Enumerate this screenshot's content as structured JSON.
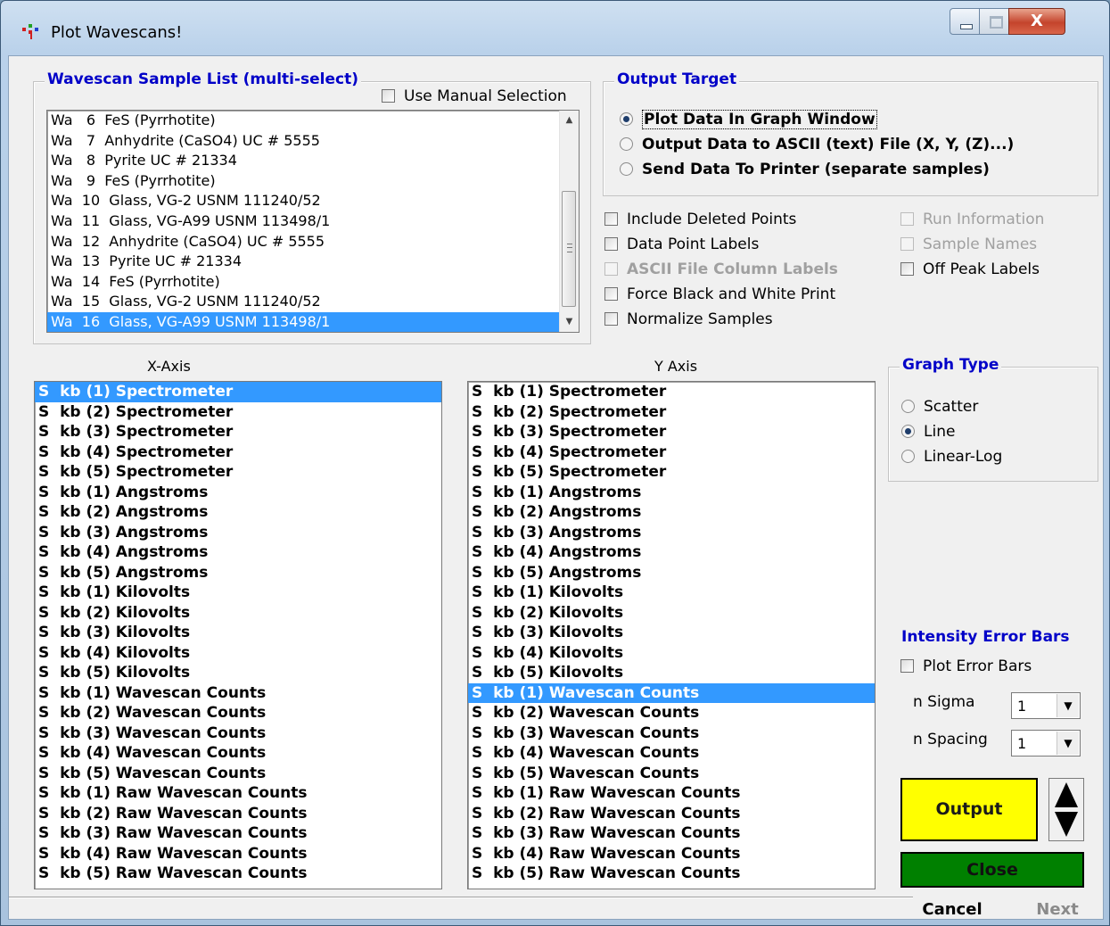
{
  "window": {
    "title": "Plot Wavescans!"
  },
  "controls": {
    "close_glyph": "X"
  },
  "sample_list": {
    "legend": "Wavescan Sample List (multi-select)",
    "manual_selection_label": "Use Manual Selection",
    "items": [
      "Wa   6  FeS (Pyrrhotite)",
      "Wa   7  Anhydrite (CaSO4) UC # 5555",
      "Wa   8  Pyrite UC # 21334",
      "Wa   9  FeS (Pyrrhotite)",
      "Wa  10  Glass, VG-2 USNM 111240/52",
      "Wa  11  Glass, VG-A99 USNM 113498/1",
      "Wa  12  Anhydrite (CaSO4) UC # 5555",
      "Wa  13  Pyrite UC # 21334",
      "Wa  14  FeS (Pyrrhotite)",
      "Wa  15  Glass, VG-2 USNM 111240/52",
      "Wa  16  Glass, VG-A99 USNM 113498/1"
    ],
    "selected_index": 10
  },
  "output_target": {
    "legend": "Output Target",
    "options": [
      "Plot Data In Graph Window",
      "Output Data to ASCII (text) File (X, Y, (Z)...)",
      "Send Data To Printer (separate samples)"
    ],
    "selected_index": 0
  },
  "options": {
    "include_deleted": "Include Deleted Points",
    "data_point_labels": "Data Point Labels",
    "ascii_column_labels": "ASCII File Column Labels",
    "force_bw": "Force Black and White Print",
    "normalize": "Normalize Samples",
    "run_information": "Run Information",
    "sample_names": "Sample Names",
    "off_peak_labels": "Off Peak Labels"
  },
  "x_axis": {
    "label": "X-Axis",
    "items": [
      "S  kb (1) Spectrometer",
      "S  kb (2) Spectrometer",
      "S  kb (3) Spectrometer",
      "S  kb (4) Spectrometer",
      "S  kb (5) Spectrometer",
      "S  kb (1) Angstroms",
      "S  kb (2) Angstroms",
      "S  kb (3) Angstroms",
      "S  kb (4) Angstroms",
      "S  kb (5) Angstroms",
      "S  kb (1) Kilovolts",
      "S  kb (2) Kilovolts",
      "S  kb (3) Kilovolts",
      "S  kb (4) Kilovolts",
      "S  kb (5) Kilovolts",
      "S  kb (1) Wavescan Counts",
      "S  kb (2) Wavescan Counts",
      "S  kb (3) Wavescan Counts",
      "S  kb (4) Wavescan Counts",
      "S  kb (5) Wavescan Counts",
      "S  kb (1) Raw Wavescan Counts",
      "S  kb (2) Raw Wavescan Counts",
      "S  kb (3) Raw Wavescan Counts",
      "S  kb (4) Raw Wavescan Counts",
      "S  kb (5) Raw Wavescan Counts"
    ],
    "selected_index": 0
  },
  "y_axis": {
    "label": "Y Axis",
    "items": [
      "S  kb (1) Spectrometer",
      "S  kb (2) Spectrometer",
      "S  kb (3) Spectrometer",
      "S  kb (4) Spectrometer",
      "S  kb (5) Spectrometer",
      "S  kb (1) Angstroms",
      "S  kb (2) Angstroms",
      "S  kb (3) Angstroms",
      "S  kb (4) Angstroms",
      "S  kb (5) Angstroms",
      "S  kb (1) Kilovolts",
      "S  kb (2) Kilovolts",
      "S  kb (3) Kilovolts",
      "S  kb (4) Kilovolts",
      "S  kb (5) Kilovolts",
      "S  kb (1) Wavescan Counts",
      "S  kb (2) Wavescan Counts",
      "S  kb (3) Wavescan Counts",
      "S  kb (4) Wavescan Counts",
      "S  kb (5) Wavescan Counts",
      "S  kb (1) Raw Wavescan Counts",
      "S  kb (2) Raw Wavescan Counts",
      "S  kb (3) Raw Wavescan Counts",
      "S  kb (4) Raw Wavescan Counts",
      "S  kb (5) Raw Wavescan Counts"
    ],
    "selected_index": 15
  },
  "graph_type": {
    "legend": "Graph Type",
    "options": [
      "Scatter",
      "Line",
      "Linear-Log"
    ],
    "selected_index": 1
  },
  "error_bars": {
    "legend": "Intensity Error Bars",
    "plot_label": "Plot Error Bars",
    "n_sigma_label": "n Sigma",
    "n_sigma_value": "1",
    "n_spacing_label": "n Spacing",
    "n_spacing_value": "1"
  },
  "buttons": {
    "output": "Output",
    "close": "Close",
    "cancel": "Cancel",
    "next": "Next"
  }
}
